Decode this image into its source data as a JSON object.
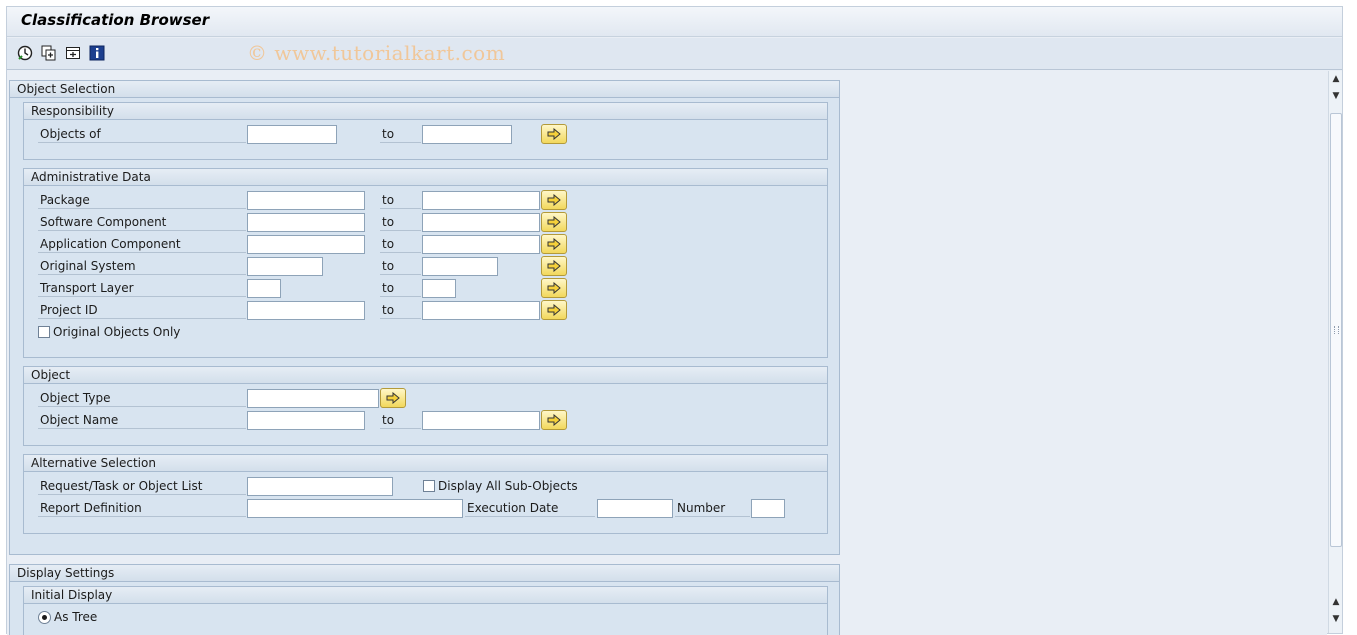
{
  "window": {
    "title": "Classification Browser",
    "watermark": "© www.tutorialkart.com"
  },
  "toolbar": {
    "icons": [
      "execute-icon",
      "get-variant-icon",
      "dynamic-selections-icon",
      "info-icon"
    ]
  },
  "object_selection": {
    "title": "Object Selection",
    "responsibility": {
      "title": "Responsibility",
      "objects_of_label": "Objects of",
      "to_label": "to",
      "objects_of_value": "",
      "objects_of_to_value": ""
    },
    "administrative_data": {
      "title": "Administrative Data",
      "rows": [
        {
          "label": "Package",
          "to": "to",
          "from_value": "",
          "to_value": ""
        },
        {
          "label": "Software Component",
          "to": "to",
          "from_value": "",
          "to_value": ""
        },
        {
          "label": "Application Component",
          "to": "to",
          "from_value": "",
          "to_value": ""
        },
        {
          "label": "Original System",
          "to": "to",
          "from_value": "",
          "to_value": ""
        },
        {
          "label": "Transport Layer",
          "to": "to",
          "from_value": "",
          "to_value": ""
        },
        {
          "label": "Project ID",
          "to": "to",
          "from_value": "",
          "to_value": ""
        }
      ],
      "original_objects_only_label": "Original Objects Only",
      "original_objects_only_checked": false
    },
    "object": {
      "title": "Object",
      "object_type_label": "Object Type",
      "object_type_value": "",
      "object_name_label": "Object Name",
      "to_label": "to",
      "object_name_value": "",
      "object_name_to_value": ""
    },
    "alternative_selection": {
      "title": "Alternative Selection",
      "request_label": "Request/Task or Object List",
      "request_value": "",
      "display_all_sub_objects_label": "Display All Sub-Objects",
      "display_all_sub_objects_checked": false,
      "report_definition_label": "Report Definition",
      "report_definition_value": "",
      "execution_date_label": "Execution Date",
      "execution_date_value": "",
      "number_label": "Number",
      "number_value": ""
    }
  },
  "display_settings": {
    "title": "Display Settings",
    "initial_display": {
      "title": "Initial Display",
      "as_tree_label": "As Tree",
      "as_tree_selected": true
    }
  }
}
